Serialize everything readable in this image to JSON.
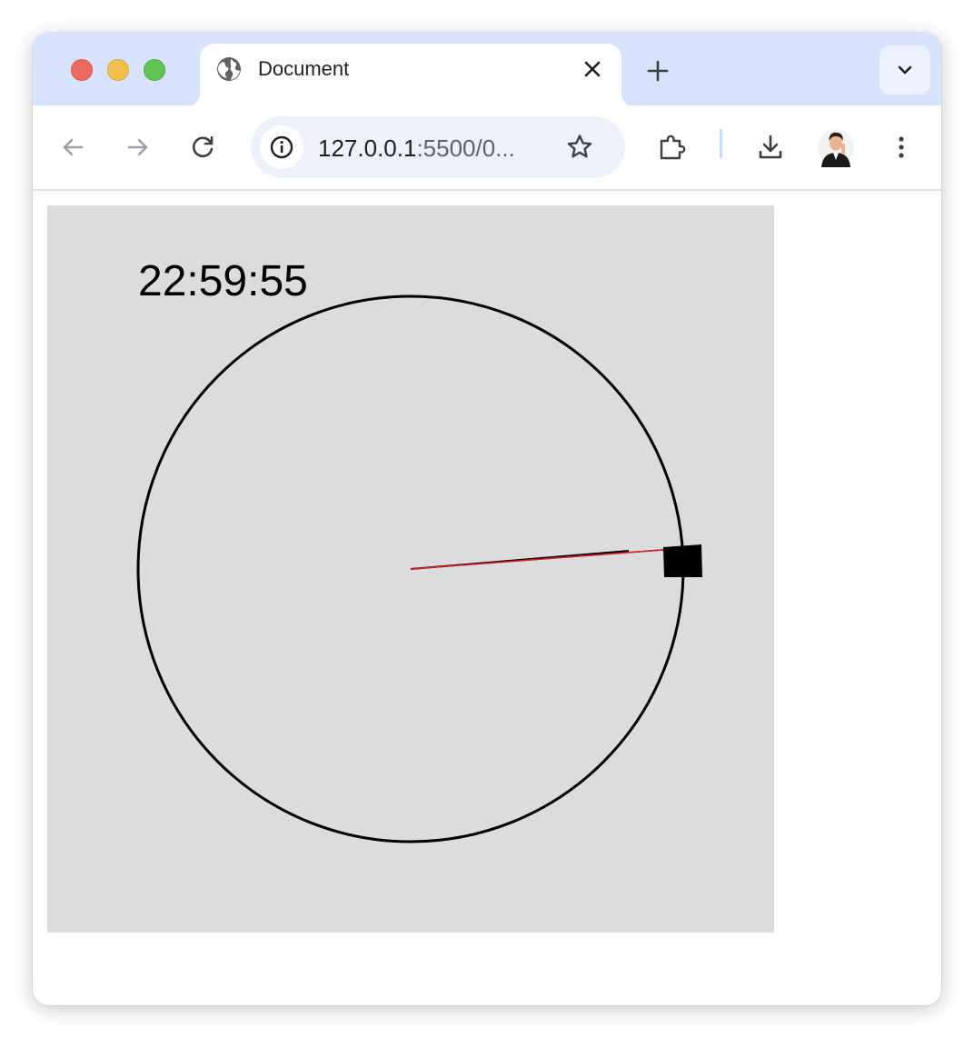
{
  "browser": {
    "tab": {
      "title": "Document",
      "favicon_icon": "globe-icon",
      "close_icon": "close-icon"
    },
    "new_tab_icon": "plus-icon",
    "tab_search_icon": "chevron-down-icon",
    "toolbar": {
      "back_icon": "arrow-left-icon",
      "forward_icon": "arrow-right-icon",
      "reload_icon": "reload-icon",
      "site_info_icon": "info-icon",
      "url_host": "127.0.0.1",
      "url_rest": ":5500/0...",
      "bookmark_icon": "star-icon",
      "extensions_icon": "puzzle-icon",
      "download_icon": "download-icon",
      "profile_icon": "avatar",
      "menu_icon": "kebab-menu-icon"
    },
    "colors": {
      "tabbar_bg": "#d7e3fb",
      "omnibox_bg": "#edf2fa"
    }
  },
  "page": {
    "time": "22:59:55",
    "colors": {
      "canvas_bg": "#dcdcdc",
      "face_stroke": "#000000",
      "second_hand": "#e02020",
      "other_hands": "#000000"
    }
  }
}
